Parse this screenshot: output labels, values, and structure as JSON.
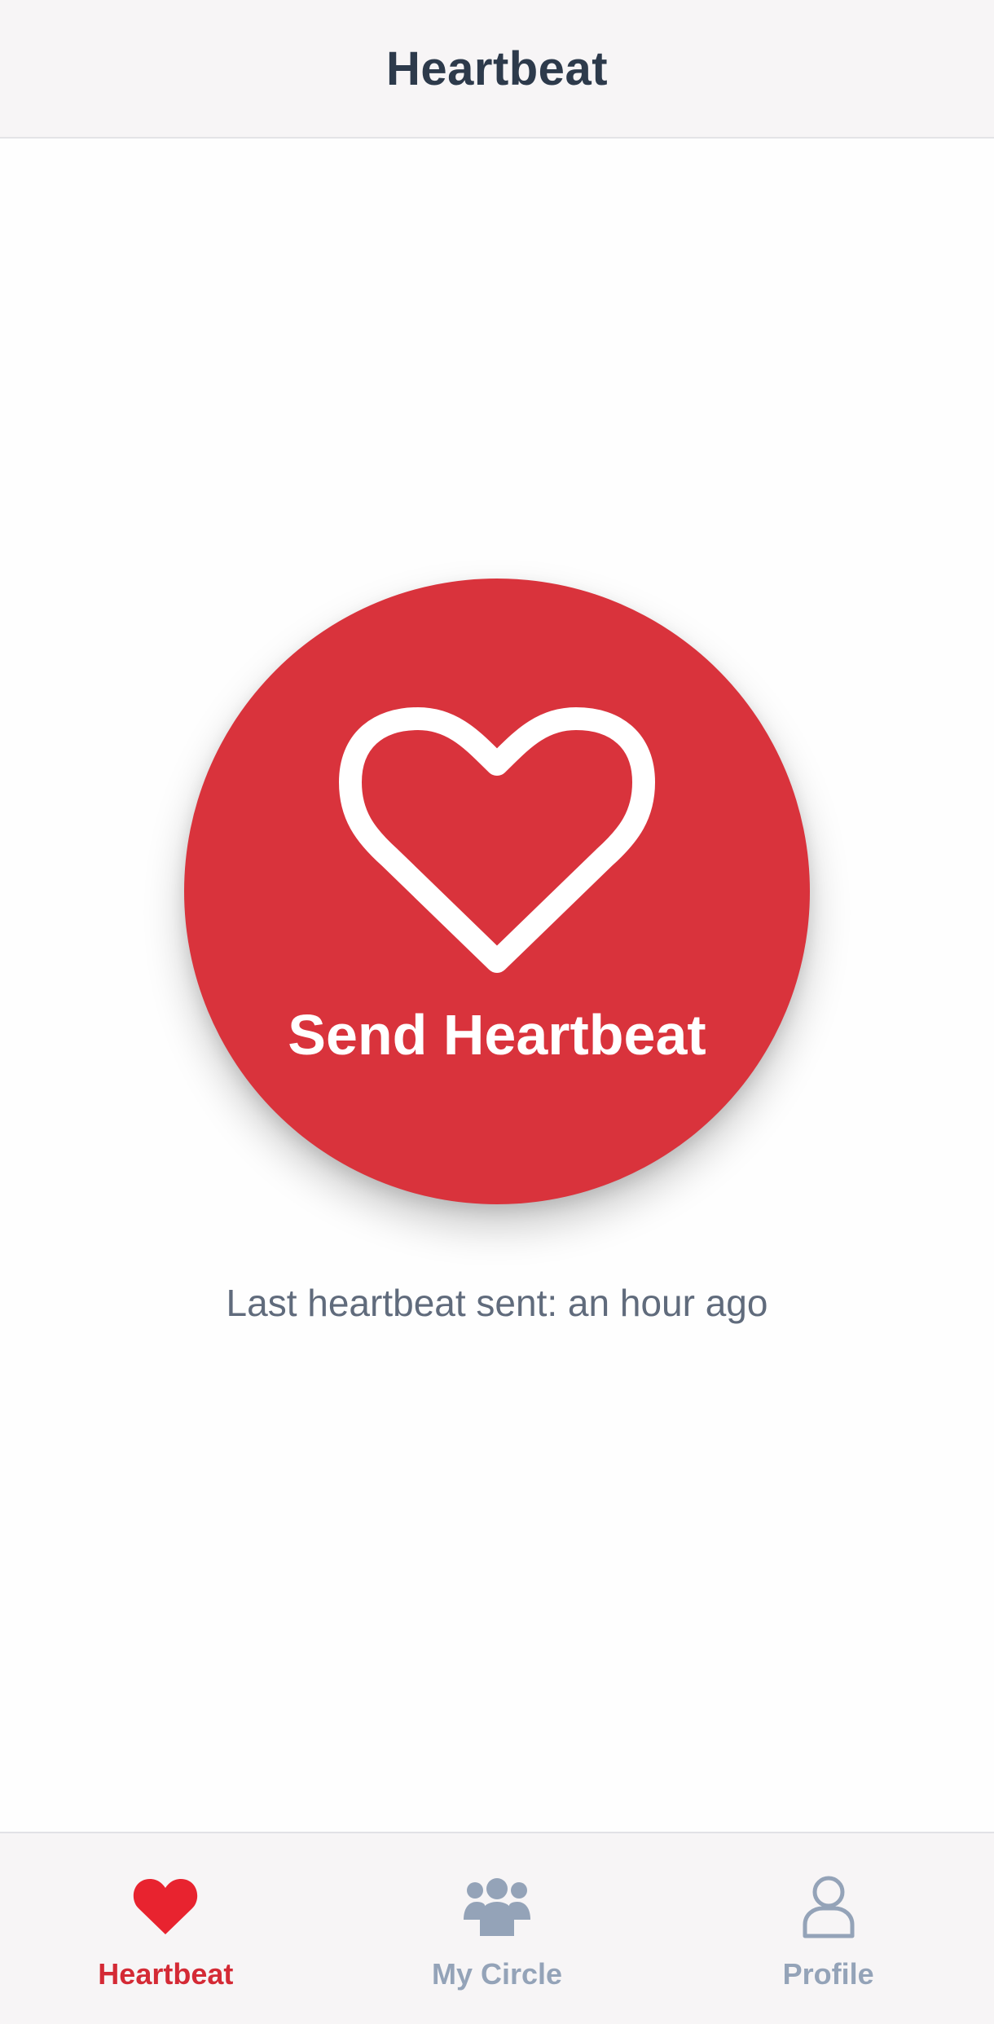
{
  "header": {
    "title": "Heartbeat"
  },
  "main": {
    "button": {
      "label": "Send Heartbeat",
      "icon": "heart-outline-icon"
    },
    "last_sent": "Last heartbeat sent: an hour ago"
  },
  "tabs": [
    {
      "label": "Heartbeat",
      "icon": "heart-icon",
      "active": true
    },
    {
      "label": "My Circle",
      "icon": "group-icon",
      "active": false
    },
    {
      "label": "Profile",
      "icon": "person-icon",
      "active": false
    }
  ],
  "colors": {
    "accent": "#d9333c",
    "tab_active": "#d42a35",
    "tab_inactive": "#94a3b8",
    "title": "#2d3a4b",
    "subtext": "#606b7c"
  }
}
